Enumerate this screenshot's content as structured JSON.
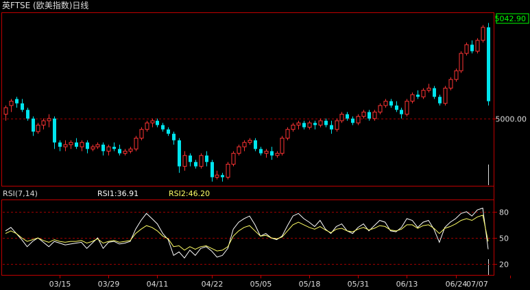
{
  "header": {
    "title": "英FTSE (欧美指数)日线"
  },
  "colors": {
    "up": "#ff3333",
    "down": "#00e5ee",
    "frame": "#c00000",
    "grid": "#a00000",
    "rsi1": "#ffffff",
    "rsi2": "#ffff66",
    "text": "#dddddd",
    "last_price": "#00ff00"
  },
  "chart_data": [
    {
      "type": "candlestick",
      "title": "英FTSE (欧美指数)日线",
      "ylim": [
        4970,
        5047
      ],
      "yticks": [
        5000.0
      ],
      "ytick_labels": [
        "5000.00"
      ],
      "last_price_label": "5042.90",
      "x_tick_labels": [
        "03/15",
        "03/29",
        "04/11",
        "04/22",
        "05/05",
        "05/18",
        "05/31",
        "06/13",
        "06/24",
        "07/07"
      ],
      "x_tick_indices": [
        10,
        19,
        28,
        38,
        47,
        56,
        65,
        74,
        83,
        93
      ],
      "ohlc": [
        [
          5002,
          5006,
          4999,
          5005
        ],
        [
          5006,
          5009,
          5003,
          5008
        ],
        [
          5009,
          5010,
          5005,
          5007
        ],
        [
          5007,
          5009,
          5003,
          5004
        ],
        [
          5004,
          5005,
          4999,
          5000
        ],
        [
          5000,
          5001,
          4992,
          4994
        ],
        [
          4994,
          4998,
          4993,
          4997
        ],
        [
          4997,
          5000,
          4995,
          4999
        ],
        [
          4999,
          5002,
          4996,
          5000
        ],
        [
          5000,
          5001,
          4986,
          4989
        ],
        [
          4989,
          4990,
          4985,
          4987
        ],
        [
          4987,
          4990,
          4985,
          4988
        ],
        [
          4988,
          4990,
          4986,
          4989
        ],
        [
          4989,
          4991,
          4986,
          4987
        ],
        [
          4987,
          4990,
          4985,
          4989
        ],
        [
          4989,
          4990,
          4984,
          4986
        ],
        [
          4986,
          4988,
          4985,
          4987
        ],
        [
          4987,
          4989,
          4986,
          4988
        ],
        [
          4988,
          4989,
          4983,
          4985
        ],
        [
          4985,
          4988,
          4983,
          4987
        ],
        [
          4987,
          4989,
          4985,
          4986
        ],
        [
          4986,
          4988,
          4983,
          4984
        ],
        [
          4984,
          4986,
          4983,
          4985
        ],
        [
          4985,
          4987,
          4984,
          4986
        ],
        [
          4986,
          4992,
          4985,
          4991
        ],
        [
          4991,
          4996,
          4990,
          4995
        ],
        [
          4995,
          4999,
          4994,
          4998
        ],
        [
          4998,
          5000,
          4996,
          4999
        ],
        [
          4999,
          5000,
          4996,
          4997
        ],
        [
          4997,
          4998,
          4994,
          4995
        ],
        [
          4995,
          4996,
          4992,
          4993
        ],
        [
          4993,
          4994,
          4988,
          4990
        ],
        [
          4990,
          4991,
          4975,
          4978
        ],
        [
          4978,
          4985,
          4976,
          4983
        ],
        [
          4983,
          4984,
          4978,
          4980
        ],
        [
          4980,
          4981,
          4977,
          4978
        ],
        [
          4978,
          4984,
          4977,
          4983
        ],
        [
          4983,
          4985,
          4978,
          4980
        ],
        [
          4980,
          4981,
          4971,
          4973
        ],
        [
          4973,
          4976,
          4972,
          4974
        ],
        [
          4974,
          4975,
          4971,
          4973
        ],
        [
          4973,
          4980,
          4972,
          4979
        ],
        [
          4979,
          4985,
          4978,
          4984
        ],
        [
          4984,
          4988,
          4983,
          4987
        ],
        [
          4987,
          4990,
          4985,
          4989
        ],
        [
          4989,
          4991,
          4988,
          4990
        ],
        [
          4990,
          4991,
          4985,
          4986
        ],
        [
          4986,
          4987,
          4983,
          4984
        ],
        [
          4984,
          4986,
          4982,
          4985
        ],
        [
          4985,
          4987,
          4981,
          4983
        ],
        [
          4983,
          4985,
          4982,
          4984
        ],
        [
          4984,
          4992,
          4983,
          4991
        ],
        [
          4991,
          4996,
          4990,
          4995
        ],
        [
          4995,
          4998,
          4994,
          4997
        ],
        [
          4997,
          4999,
          4995,
          4998
        ],
        [
          4998,
          4999,
          4995,
          4996
        ],
        [
          4996,
          4999,
          4995,
          4998
        ],
        [
          4998,
          4999,
          4995,
          4997
        ],
        [
          4997,
          5000,
          4996,
          4999
        ],
        [
          4999,
          5000,
          4996,
          4997
        ],
        [
          4997,
          4999,
          4993,
          4995
        ],
        [
          4995,
          5000,
          4994,
          4999
        ],
        [
          4999,
          5003,
          4998,
          5002
        ],
        [
          5002,
          5003,
          4999,
          5000
        ],
        [
          5000,
          5001,
          4997,
          4998
        ],
        [
          4998,
          5002,
          4997,
          5001
        ],
        [
          5001,
          5004,
          5000,
          5003
        ],
        [
          5003,
          5004,
          4999,
          5000
        ],
        [
          5000,
          5004,
          4999,
          5003
        ],
        [
          5003,
          5007,
          5002,
          5006
        ],
        [
          5006,
          5009,
          5005,
          5008
        ],
        [
          5008,
          5009,
          5005,
          5006
        ],
        [
          5006,
          5008,
          5003,
          5004
        ],
        [
          5004,
          5005,
          5000,
          5002
        ],
        [
          5002,
          5009,
          5001,
          5008
        ],
        [
          5008,
          5012,
          5007,
          5011
        ],
        [
          5011,
          5013,
          5009,
          5010
        ],
        [
          5010,
          5014,
          5009,
          5013
        ],
        [
          5013,
          5016,
          5012,
          5014
        ],
        [
          5014,
          5015,
          5009,
          5010
        ],
        [
          5010,
          5011,
          5006,
          5007
        ],
        [
          5007,
          5015,
          5006,
          5014
        ],
        [
          5014,
          5019,
          5013,
          5018
        ],
        [
          5018,
          5023,
          5017,
          5022
        ],
        [
          5022,
          5031,
          5021,
          5030
        ],
        [
          5030,
          5035,
          5029,
          5034
        ],
        [
          5034,
          5036,
          5030,
          5031
        ],
        [
          5031,
          5037,
          5030,
          5036
        ],
        [
          5036,
          5043,
          5035,
          5042
        ],
        [
          5042,
          5044,
          5006,
          5008
        ]
      ],
      "volume_spike_last": true
    },
    {
      "type": "line",
      "title": "RSI(7,14)",
      "ylim": [
        10,
        90
      ],
      "yticks": [
        20,
        50,
        80
      ],
      "series": [
        {
          "name": "RSI1",
          "value_label": "RSI1:36.91",
          "values": [
            58,
            62,
            55,
            48,
            40,
            46,
            50,
            45,
            40,
            46,
            44,
            42,
            43,
            44,
            45,
            38,
            44,
            50,
            38,
            45,
            46,
            43,
            44,
            46,
            60,
            70,
            78,
            72,
            66,
            55,
            48,
            30,
            34,
            27,
            36,
            30,
            38,
            40,
            35,
            28,
            30,
            38,
            60,
            68,
            72,
            75,
            65,
            52,
            55,
            50,
            48,
            52,
            64,
            75,
            78,
            72,
            68,
            63,
            70,
            60,
            55,
            63,
            66,
            58,
            55,
            62,
            66,
            58,
            64,
            70,
            68,
            58,
            57,
            62,
            72,
            70,
            62,
            68,
            70,
            60,
            45,
            62,
            68,
            72,
            78,
            80,
            75,
            82,
            84,
            37
          ]
        },
        {
          "name": "RSI2",
          "value_label": "RSI2:46.20",
          "values": [
            55,
            58,
            55,
            50,
            46,
            48,
            50,
            47,
            45,
            48,
            46,
            45,
            46,
            46,
            47,
            44,
            46,
            49,
            44,
            46,
            47,
            45,
            46,
            47,
            55,
            60,
            64,
            62,
            58,
            52,
            49,
            40,
            41,
            36,
            40,
            37,
            40,
            41,
            38,
            35,
            36,
            40,
            52,
            58,
            62,
            64,
            58,
            52,
            53,
            50,
            49,
            51,
            58,
            65,
            68,
            65,
            62,
            60,
            63,
            59,
            56,
            60,
            61,
            58,
            57,
            60,
            62,
            59,
            61,
            64,
            63,
            59,
            58,
            60,
            65,
            65,
            61,
            64,
            65,
            61,
            55,
            61,
            63,
            66,
            70,
            72,
            70,
            74,
            76,
            46
          ]
        }
      ]
    }
  ]
}
